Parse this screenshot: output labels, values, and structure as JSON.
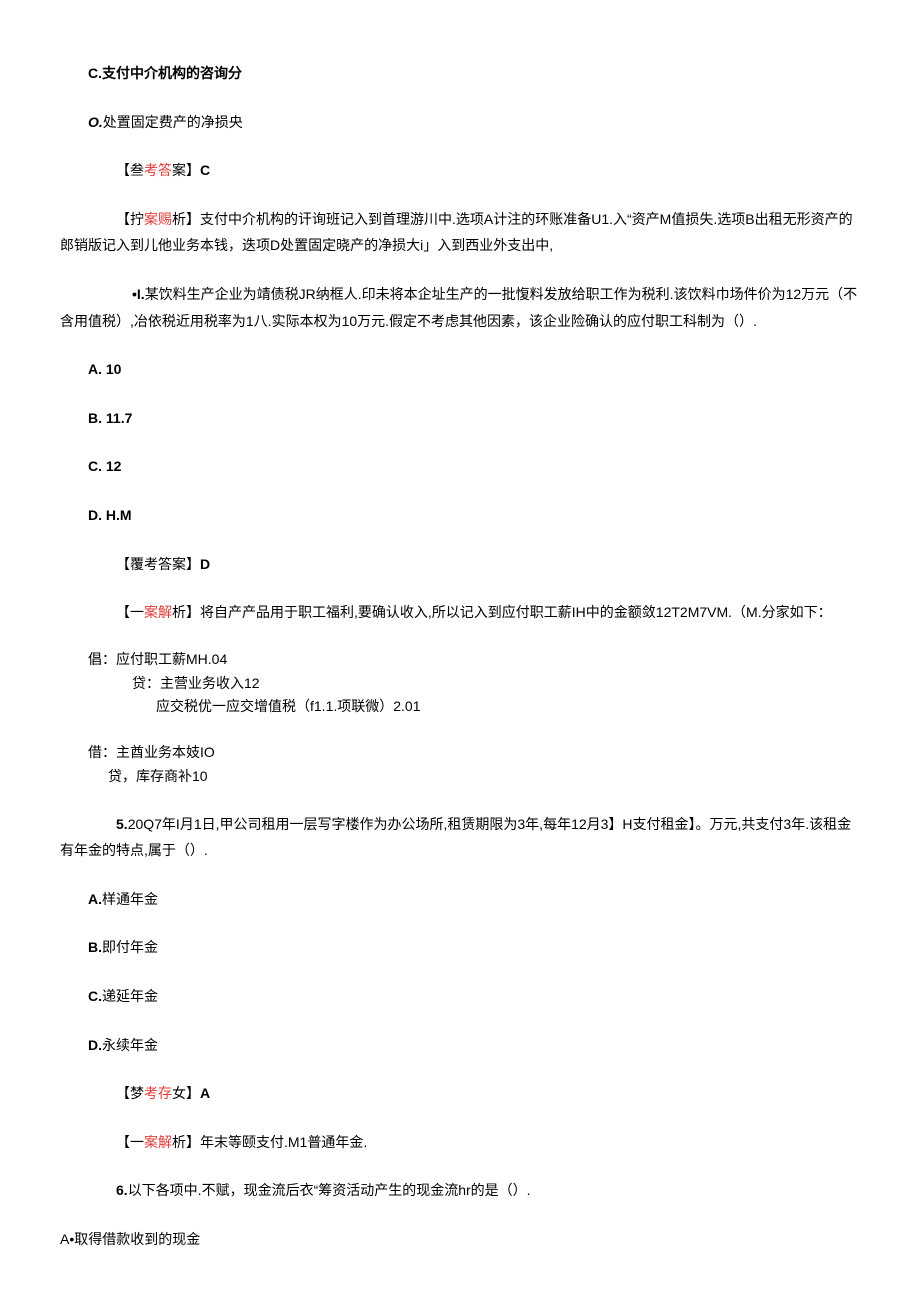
{
  "q3": {
    "optC": "C.支付中介机构的咨询分",
    "optD_prefix": "O.",
    "optD": "处置固定费产的净损央",
    "ans_prefix": "【叁",
    "ans_mid": "考答",
    "ans_suffix": "案】",
    "ans_val": "C",
    "exp_prefix": "【拧",
    "exp_mid": "案赐",
    "exp_suffix": "析】",
    "exp_text": "支付中介机构的讦询班记入到首理游川中.选项A计注的环账准备U1.入“资产M值损失.选项B出租无形资产的郎销版记入到儿他业务本钱，迭项D处置固定晓产的净损大i」入到西业外支出中,"
  },
  "q4": {
    "stem_prefix": "•I.",
    "stem": "某饮料生产企业为靖债税JR纳框人.印未将本企址生产的一批愎料发放给职工作为税利.该饮料巾场件价为12万元（不含用值税）,冶依税近用税率为1八.实际本权为10万元.假定不考虑其他因素，该企业险确认的应付职工科制为（）.",
    "optA": "A.    10",
    "optB": "B.    11.7",
    "optC": "C.     12",
    "optD": "D.    H.M",
    "ans_prefix": "【覆考答案】",
    "ans_val": "D",
    "exp_prefix": "【一",
    "exp_mid": "案解",
    "exp_suffix": "析】",
    "exp_text": "将自产产品用于职工福利,要确认收入,所以记入到应付职工薪IH中的金额敛12T2M7VM.（M.分家如下：",
    "entry1": "倡：应付职工薪MH.04",
    "entry2": "贷：主营业务收入12",
    "entry3": "应交税优一应交增值税（f1.1.项联微）2.01",
    "entry4": "借：主酋业务本妓IO",
    "entry5": "贷，库存商补10"
  },
  "q5": {
    "stem_prefix": "5.",
    "stem": "20Q7年I月1日,甲公司租用一层写字楼作为办公场所,租赁期限为3年,每年12月3】H支付租金】。万元,共支付3年.该租金有年金的特点,属于（）.",
    "optA": "A.样通年金",
    "optB": "B.即付年金",
    "optC": "C.递延年金",
    "optD": "D.永续年金",
    "ans_prefix": "【梦",
    "ans_mid": "考存",
    "ans_suffix": "女】",
    "ans_val": "A",
    "exp_prefix": "【一",
    "exp_mid": "案解",
    "exp_suffix": "析】",
    "exp_text": "年末等颐支付.M1普通年金."
  },
  "q6": {
    "stem_prefix": "6.",
    "stem": "以下各项中.不赋，现金流后衣“筹资活动产生的现金流hr的是（）.",
    "optA": "A•取得借款收到的现金"
  }
}
